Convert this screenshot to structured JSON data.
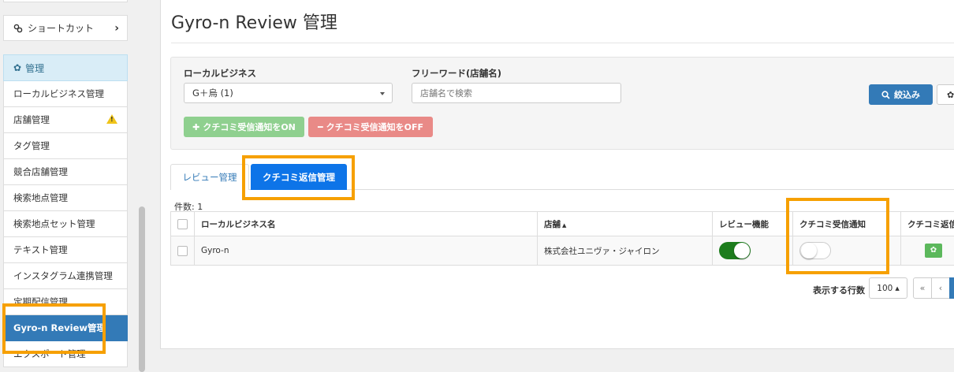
{
  "sidebar": {
    "shortcut_label": "ショートカット",
    "section_label": "管理",
    "items": [
      {
        "label": "ローカルビジネス管理"
      },
      {
        "label": "店舗管理",
        "warn_mark": "!"
      },
      {
        "label": "タグ管理"
      },
      {
        "label": "競合店舗管理"
      },
      {
        "label": "検索地点管理"
      },
      {
        "label": "検索地点セット管理"
      },
      {
        "label": "テキスト管理"
      },
      {
        "label": "インスタグラム連携管理"
      },
      {
        "label": "定期配信管理"
      },
      {
        "label": "Gyro-n Review管理"
      },
      {
        "label": "エクスポート管理"
      }
    ]
  },
  "main": {
    "title": "Gyro-n Review 管理",
    "filter": {
      "business_label": "ローカルビジネス",
      "business_value": "G＋烏 (1)",
      "keyword_label": "フリーワード(店舗名)",
      "keyword_placeholder": "店舗名で検索",
      "on_button": "クチコミ受信通知をON",
      "off_button": "クチコミ受信通知をOFF",
      "search_button": "絞込み"
    },
    "tabs": [
      {
        "label": "レビュー管理"
      },
      {
        "label": "クチコミ返信管理"
      }
    ],
    "count_label": "件数: 1",
    "table": {
      "headers": [
        "ローカルビジネス名",
        "店舗",
        "レビュー機能",
        "クチコミ受信通知",
        "クチコミ返信"
      ],
      "rows": [
        {
          "business": "Gyro-n",
          "store": "株式会社ユニヴァ・ジャイロン",
          "review_on": true,
          "notify_on": false
        }
      ]
    },
    "rows_label": "表示する行数",
    "rows_value": "100",
    "pager": {
      "first": "«",
      "prev": "‹"
    }
  },
  "colors": {
    "highlight": "#f6a000",
    "primary": "#337ab7",
    "tab_active": "#0d74e8",
    "toggle_on": "#1d7d1d"
  }
}
